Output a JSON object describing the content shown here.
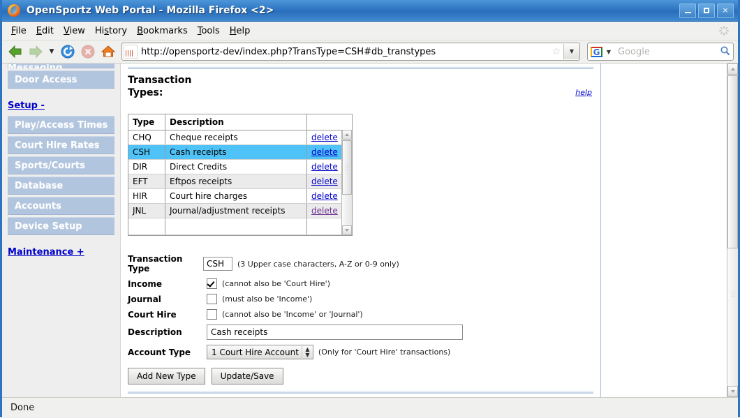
{
  "window": {
    "title": "OpenSportz Web Portal - Mozilla Firefox <2>",
    "minimize_label": "Minimize",
    "maximize_label": "Maximize",
    "close_label": "×"
  },
  "menubar": {
    "items": [
      {
        "label": "File",
        "accel": "F"
      },
      {
        "label": "Edit",
        "accel": "E"
      },
      {
        "label": "View",
        "accel": "V"
      },
      {
        "label": "History",
        "accel": "s"
      },
      {
        "label": "Bookmarks",
        "accel": "B"
      },
      {
        "label": "Tools",
        "accel": "T"
      },
      {
        "label": "Help",
        "accel": "H"
      }
    ]
  },
  "toolbar": {
    "back_icon": "arrow-left-icon",
    "forward_icon": "arrow-right-icon",
    "dropdown_icon": "chevron-down-icon",
    "reload_icon": "reload-icon",
    "stop_icon": "stop-icon",
    "home_icon": "home-icon",
    "url": "http://opensportz-dev/index.php?TransType=CSH#db_transtypes",
    "star_glyph": "☆",
    "go_glyph": "▼",
    "search_engine": "G",
    "search_placeholder": "Google",
    "search_value": "",
    "search_glyph": "⌕"
  },
  "sidebar": {
    "clipped_item": {
      "label": "Messaging"
    },
    "items_top": [
      {
        "label": "Door Access"
      }
    ],
    "setup_link": "Setup -",
    "items_setup": [
      {
        "label": "Play/Access Times"
      },
      {
        "label": "Court Hire Rates"
      },
      {
        "label": "Sports/Courts"
      },
      {
        "label": "Database"
      },
      {
        "label": "Accounts"
      },
      {
        "label": "Device Setup"
      }
    ],
    "maintenance_link": "Maintenance +"
  },
  "content": {
    "heading": "Transaction Types:",
    "help_label": "help",
    "table": {
      "columns": [
        "Type",
        "Description",
        ""
      ],
      "rows": [
        {
          "type": "CHQ",
          "description": "Cheque receipts",
          "action": "delete",
          "selected": false,
          "visited": false
        },
        {
          "type": "CSH",
          "description": "Cash receipts",
          "action": "delete",
          "selected": true,
          "visited": false
        },
        {
          "type": "DIR",
          "description": "Direct Credits",
          "action": "delete",
          "selected": false,
          "visited": false
        },
        {
          "type": "EFT",
          "description": "Eftpos receipts",
          "action": "delete",
          "selected": false,
          "visited": false
        },
        {
          "type": "HIR",
          "description": "Court hire charges",
          "action": "delete",
          "selected": false,
          "visited": false
        },
        {
          "type": "JNL",
          "description": "Journal/adjustment receipts",
          "action": "delete",
          "selected": false,
          "visited": true
        }
      ]
    },
    "form": {
      "transaction_type": {
        "label": "Transaction Type",
        "value": "CSH",
        "hint": "(3 Upper case characters, A-Z or 0-9 only)"
      },
      "income": {
        "label": "Income",
        "checked": true,
        "hint": "(cannot also be 'Court Hire')"
      },
      "journal": {
        "label": "Journal",
        "checked": false,
        "hint": "(must also be 'Income')"
      },
      "court_hire": {
        "label": "Court Hire",
        "checked": false,
        "hint": "(cannot also be 'Income' or 'Journal')"
      },
      "description": {
        "label": "Description",
        "value": "Cash receipts"
      },
      "account_type": {
        "label": "Account Type",
        "value": "1   Court Hire Account",
        "hint": "(Only for 'Court Hire' transactions)"
      },
      "add_button": "Add New Type",
      "save_button": "Update/Save"
    }
  },
  "statusbar": {
    "text": "Done"
  },
  "colors": {
    "titlebar": "#2e76c2",
    "selected_row": "#4fc3f7",
    "link": "#0000cc",
    "visited_link": "#6b2f8f",
    "nav_button": "#b2c5de"
  }
}
